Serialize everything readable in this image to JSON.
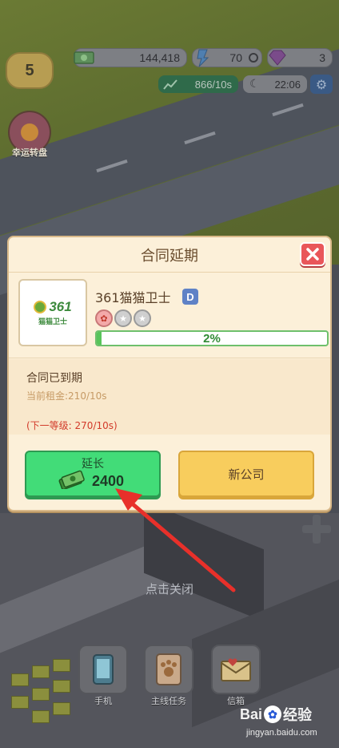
{
  "hud": {
    "level": "5",
    "cash": "144,418",
    "gems": "70",
    "diamonds": "3",
    "income_rate": "866/10s",
    "time": "22:06",
    "lucky_wheel_label": "幸运转盘"
  },
  "modal": {
    "title": "合同延期",
    "company": {
      "name": "361猫猫卫士",
      "grade": "D",
      "logo_number": "361",
      "logo_text": "猫猫卫士",
      "progress": 0.02,
      "progress_text": "2%"
    },
    "status": "合同已到期",
    "current_rent": "当前租金:210/10s",
    "next_level": "(下一等级: 270/10s)",
    "extend_button": {
      "label": "延长",
      "cost": "2400"
    },
    "new_company_button": {
      "label": "新公司"
    }
  },
  "tap_to_close": "点击关闭",
  "bottom_bar": [
    {
      "label": "手机",
      "icon": "phone-icon"
    },
    {
      "label": "主线任务",
      "icon": "paw-card-icon"
    },
    {
      "label": "信箱",
      "icon": "mail-icon"
    }
  ],
  "watermark": {
    "brand": "Bai",
    "brand2": "经验",
    "url": "jingyan.baidu.com"
  },
  "colors": {
    "accent_green": "#42dc78",
    "accent_yellow": "#f8cd5d",
    "close_red": "#e9565a",
    "arrow_red": "#e8302a"
  }
}
